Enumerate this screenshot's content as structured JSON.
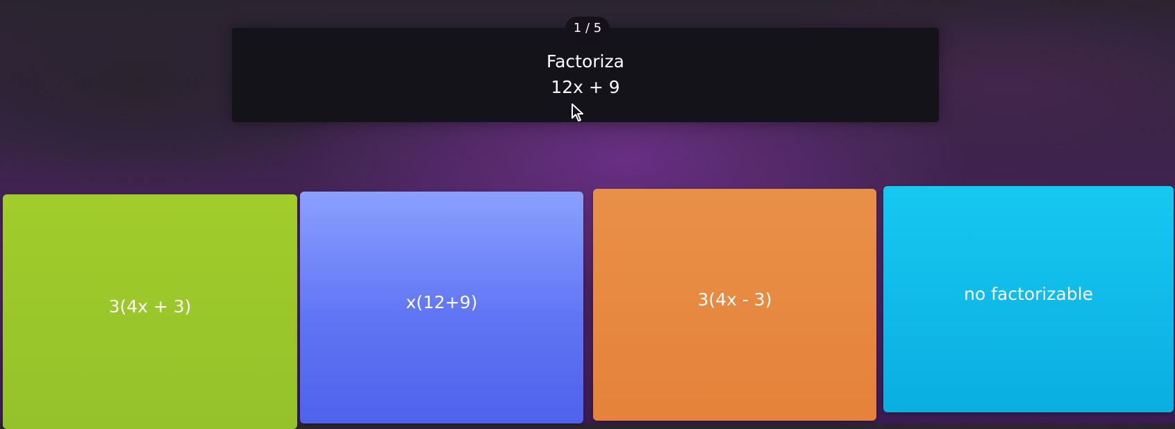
{
  "quiz": {
    "counter": "1 / 5",
    "question_title": "Factoriza",
    "question_expression": "12x + 9"
  },
  "answers": [
    {
      "label": "3(4x + 3)",
      "color": "#9ec82c"
    },
    {
      "label": "x(12+9)",
      "color": "#6a7ef6"
    },
    {
      "label": "3(4x - 3)",
      "color": "#e68a40"
    },
    {
      "label": "no factorizable",
      "color": "#10bce8"
    }
  ],
  "icons": {
    "cursor": "mouse-pointer-icon"
  }
}
